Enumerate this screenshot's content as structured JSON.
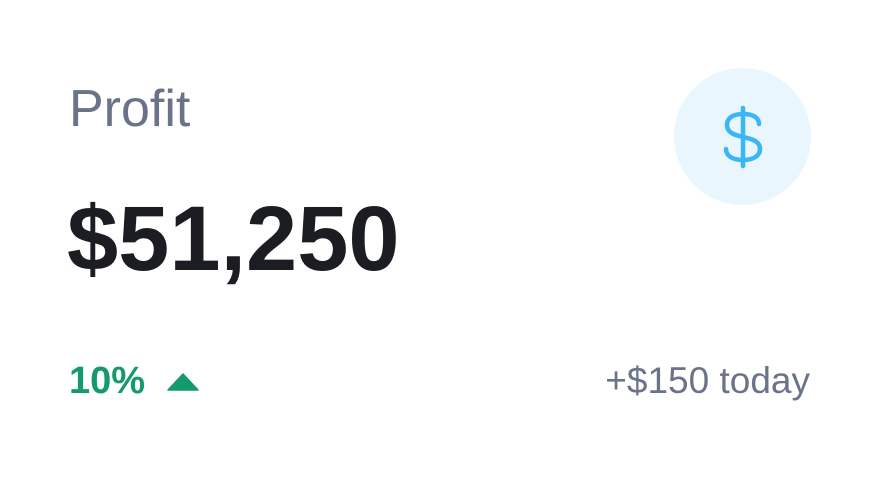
{
  "card": {
    "title": "Profit",
    "value": "$51,250",
    "change_percent": "10%",
    "change_direction": "up",
    "today_delta": "+$150 today",
    "icon": "dollar-icon"
  },
  "colors": {
    "title": "#6b7388",
    "value": "#1b1d22",
    "positive": "#159a6b",
    "icon": "#38b6f5",
    "icon_background": "#e9f6fe"
  }
}
